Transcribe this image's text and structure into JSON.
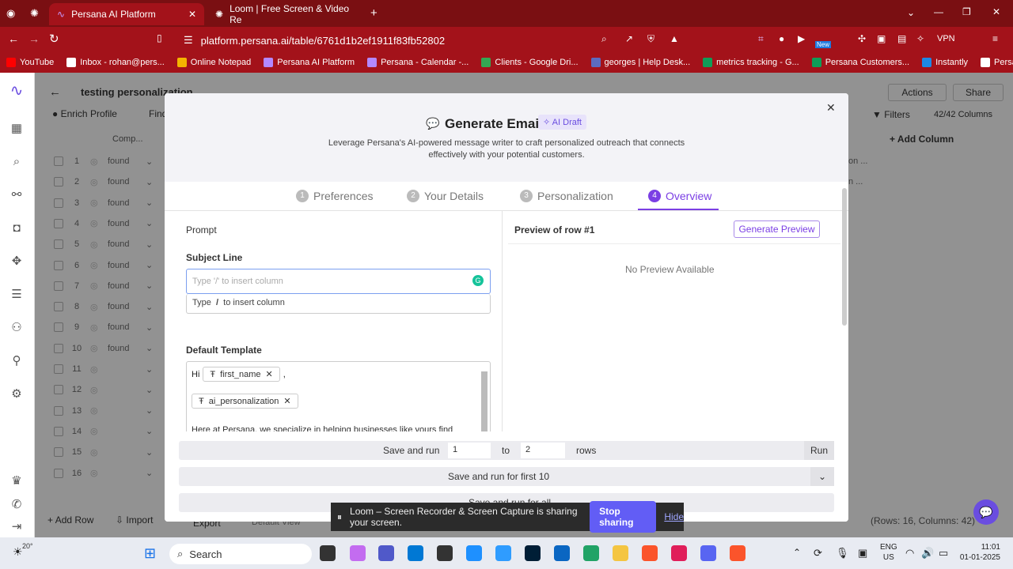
{
  "browser": {
    "tabs": [
      {
        "label": "Persana AI Platform",
        "active": true
      },
      {
        "label": "Loom | Free Screen & Video Re"
      }
    ],
    "url": "platform.persana.ai/table/6761d1b2ef1911f83fb52802",
    "vpn": "VPN",
    "bookmarks": [
      "YouTube",
      "Inbox - rohan@pers...",
      "Online Notepad",
      "Persana AI Platform",
      "Persana - Calendar -...",
      "Clients - Google Dri...",
      "georges | Help Desk...",
      "metrics tracking - G...",
      "Persana Customers...",
      "Instantly",
      "Persana AI"
    ],
    "new_badge": "New"
  },
  "app": {
    "table_title": "testing personalization",
    "tabs": [
      "Enrich Profile",
      "Find"
    ],
    "col_header": "Comp...",
    "rows": [
      {
        "n": "1",
        "v": "found"
      },
      {
        "n": "2",
        "v": "found"
      },
      {
        "n": "3",
        "v": "found"
      },
      {
        "n": "4",
        "v": "found"
      },
      {
        "n": "5",
        "v": "found"
      },
      {
        "n": "6",
        "v": "found"
      },
      {
        "n": "7",
        "v": "found"
      },
      {
        "n": "8",
        "v": "found"
      },
      {
        "n": "9",
        "v": "found"
      },
      {
        "n": "10",
        "v": "found"
      },
      {
        "n": "11",
        "v": ""
      },
      {
        "n": "12",
        "v": ""
      },
      {
        "n": "13",
        "v": ""
      },
      {
        "n": "14",
        "v": ""
      },
      {
        "n": "15",
        "v": ""
      },
      {
        "n": "16",
        "v": ""
      }
    ],
    "actions_label": "Actions",
    "share_label": "Share",
    "filters_label": "Filters",
    "columns_count": "42/42 Columns",
    "add_column_label": "Add Column",
    "right_cells": [
      "on ...",
      "n ..."
    ],
    "add_row_label": "Add Row",
    "import_label": "Import",
    "export_label": "Export",
    "default_view_label": "Default View",
    "status": "(Rows: 16, Columns: 42)"
  },
  "modal": {
    "title": "Generate Email",
    "badge": "AI Draft",
    "description": "Leverage Persana's AI-powered message writer to craft personalized outreach that connects effectively with your potential customers.",
    "steps": [
      {
        "num": "1",
        "label": "Preferences"
      },
      {
        "num": "2",
        "label": "Your Details"
      },
      {
        "num": "3",
        "label": "Personalization"
      },
      {
        "num": "4",
        "label": "Overview"
      }
    ],
    "prompt_label": "Prompt",
    "preview_title": "Preview of row #1",
    "generate_preview": "Generate Preview",
    "no_preview": "No Preview Available",
    "subject_label": "Subject Line",
    "subject_placeholder": "Type '/' to insert column",
    "hint_type": "Type",
    "hint_slash": "/",
    "hint_rest": "to insert column",
    "template_label": "Default Template",
    "template_hi": "Hi",
    "chip1": "first_name",
    "comma": ",",
    "chip2": "ai_personalization",
    "template_line": "Here at Persana, we specialize in helping businesses like yours find",
    "save_and_run": "Save and run",
    "from": "1",
    "to_label": "to",
    "to": "2",
    "rows_label": "rows",
    "run": "Run",
    "first10": "Save and run for first 10",
    "all": "Save and run for all"
  },
  "loom": {
    "text": "Loom – Screen Recorder & Screen Capture is sharing your screen.",
    "stop": "Stop sharing",
    "hide": "Hide"
  },
  "taskbar": {
    "temp": "20°",
    "search": "Search",
    "lang1": "ENG",
    "lang2": "US",
    "time": "11:01",
    "date": "01-01-2025"
  },
  "colors": {
    "browser": "#a3121a",
    "accent": "#7b3fe4"
  }
}
